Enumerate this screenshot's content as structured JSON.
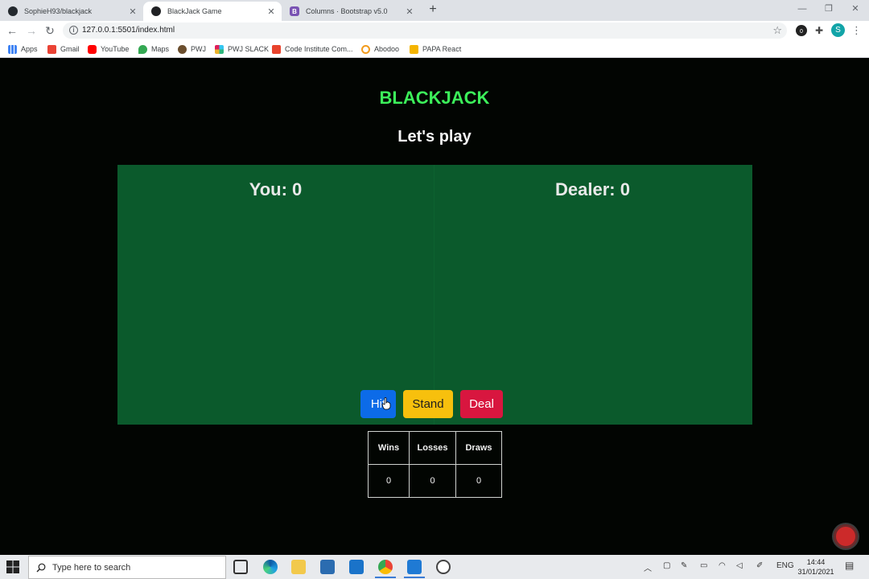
{
  "browser": {
    "tabs": [
      {
        "title": "SophieH93/blackjack",
        "icon": "github-icon",
        "active": false
      },
      {
        "title": "BlackJack Game",
        "icon": "globe-icon",
        "active": true
      },
      {
        "title": "Columns · Bootstrap v5.0",
        "icon": "bootstrap-icon",
        "active": false
      }
    ],
    "new_tab": "+",
    "url": "127.0.0.1:5501/index.html",
    "profile_initial": "S",
    "extension_badge": "0",
    "bookmarks": [
      "Apps",
      "Gmail",
      "YouTube",
      "Maps",
      "PWJ",
      "PWJ SLACK",
      "Code Institute Com...",
      "Abodoo",
      "PAPA React"
    ]
  },
  "game": {
    "title": "BLACKJACK",
    "subtitle": "Let's play",
    "you_score": "You: 0",
    "dealer_score": "Dealer: 0",
    "buttons": {
      "hit": "Hit",
      "stand": "Stand",
      "deal": "Deal"
    },
    "stats": {
      "headers": [
        "Wins",
        "Losses",
        "Draws"
      ],
      "values": [
        "0",
        "0",
        "0"
      ]
    }
  },
  "taskbar": {
    "search_placeholder": "Type here to search",
    "language": "ENG",
    "time": "14:44",
    "date": "31/01/2021"
  },
  "colors": {
    "title_green": "#3cf05a",
    "table_green": "#0b5a2c",
    "hit_blue": "#0c6be8",
    "stand_yellow": "#f7c00d",
    "deal_red": "#d8163f"
  }
}
